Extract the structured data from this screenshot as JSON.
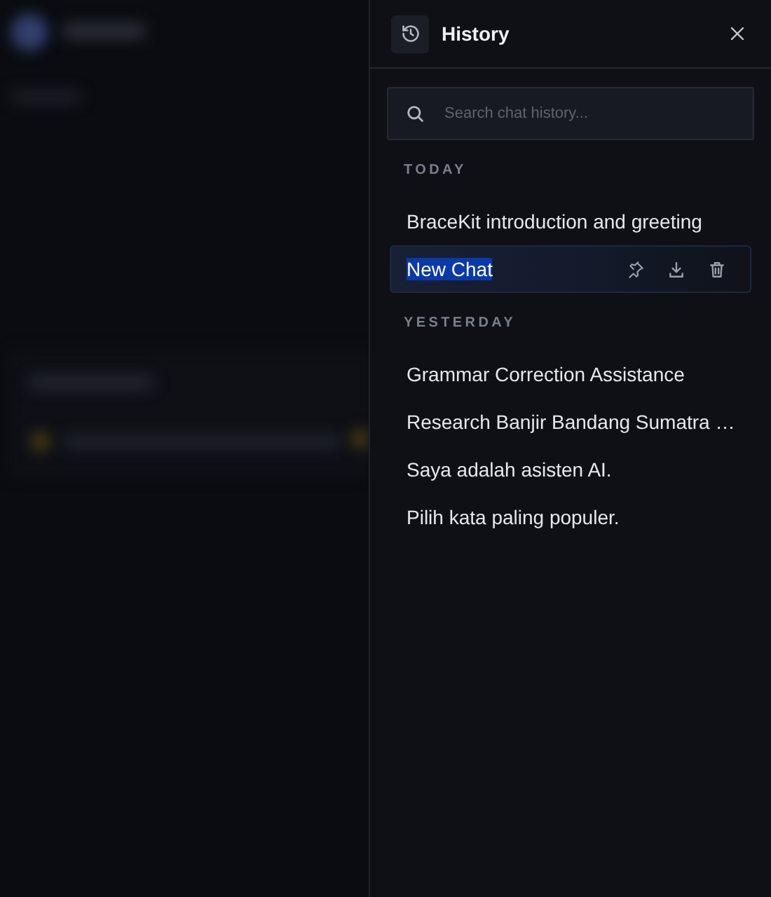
{
  "panel": {
    "title": "History",
    "search": {
      "placeholder": "Search chat history..."
    },
    "groups": [
      {
        "label": "TODAY",
        "items": [
          {
            "title": "BraceKit introduction and greeting",
            "selected": false
          },
          {
            "title": "New Chat",
            "selected": true
          }
        ]
      },
      {
        "label": "YESTERDAY",
        "items": [
          {
            "title": "Grammar Correction Assistance",
            "selected": false
          },
          {
            "title": "Research Banjir Bandang Sumatra …",
            "selected": false
          },
          {
            "title": "Saya adalah asisten AI.",
            "selected": false
          },
          {
            "title": "Pilih kata paling populer.",
            "selected": false
          }
        ]
      }
    ]
  }
}
